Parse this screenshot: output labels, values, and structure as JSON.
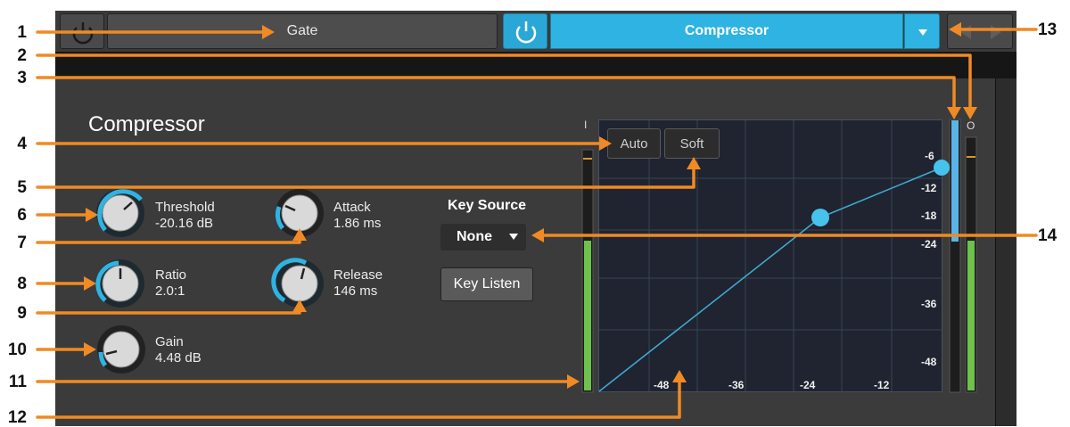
{
  "callouts": [
    "1",
    "2",
    "3",
    "4",
    "5",
    "6",
    "7",
    "8",
    "9",
    "10",
    "11",
    "12",
    "13",
    "14"
  ],
  "header": {
    "gate_label": "Gate",
    "compressor_label": "Compressor"
  },
  "compressor": {
    "title": "Compressor",
    "knobs": {
      "threshold": {
        "label": "Threshold",
        "value": "-20.16 dB"
      },
      "attack": {
        "label": "Attack",
        "value": "1.86 ms"
      },
      "ratio": {
        "label": "Ratio",
        "value": "2.0:1"
      },
      "release": {
        "label": "Release",
        "value": "146 ms"
      },
      "gain": {
        "label": "Gain",
        "value": "4.48 dB"
      }
    },
    "key_source": {
      "label": "Key Source",
      "value": "None"
    },
    "key_listen_label": "Key Listen",
    "auto_label": "Auto",
    "soft_label": "Soft",
    "input_meter_label": "I",
    "output_meter_label": "O",
    "graph": {
      "x_ticks": [
        "-48",
        "-36",
        "-24",
        "-12"
      ],
      "y_ticks": [
        "-6",
        "-12",
        "-18",
        "-24",
        "-36",
        "-48"
      ]
    }
  },
  "colors": {
    "accent": "#2fb3e2",
    "callout_orange": "#f08a24",
    "meter_green": "#6cc24a",
    "meter_blue": "#5ab4e8",
    "panel_bg": "#3b3b3b"
  }
}
